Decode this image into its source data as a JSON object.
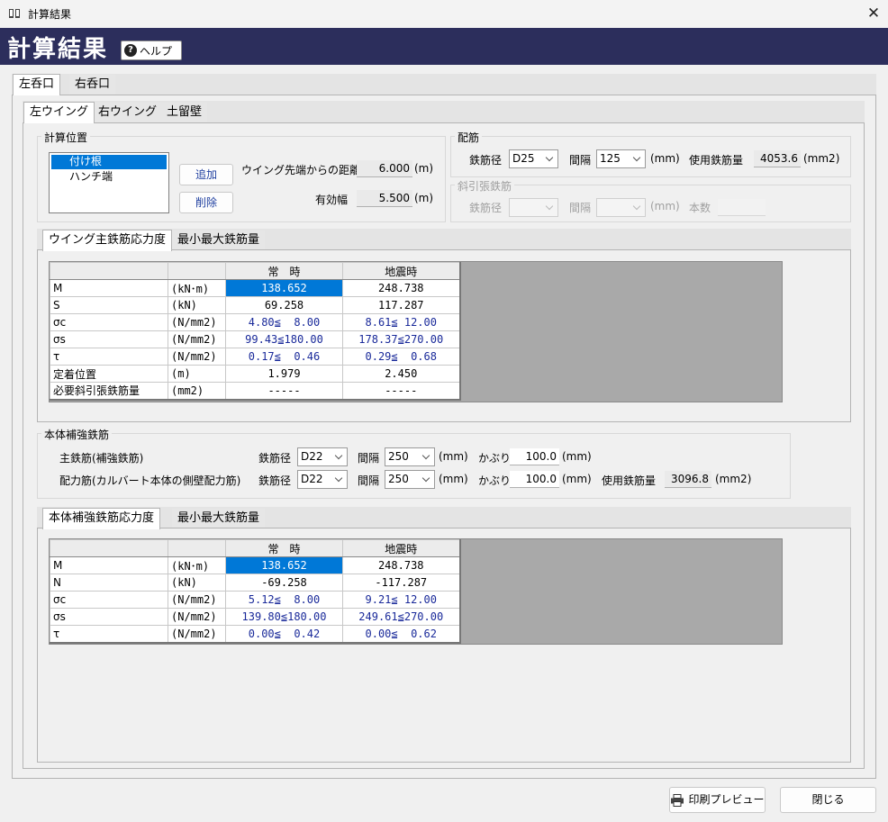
{
  "window": {
    "title": "計算結果",
    "close": "✕"
  },
  "header": {
    "title": "計算結果",
    "help_label": "ヘルプ"
  },
  "outer_tabs": [
    "左呑口",
    "右呑口"
  ],
  "inner_tabs": [
    "左ウイング",
    "右ウイング",
    "土留壁"
  ],
  "calc_position": {
    "label": "計算位置",
    "items": [
      "付け根",
      "ハンチ端"
    ],
    "selected": 0,
    "add_label": "追加",
    "delete_label": "削除",
    "distance_label": "ウイング先端からの距離",
    "distance_value": "6.000",
    "distance_unit": "(m)",
    "width_label": "有効幅",
    "width_value": "5.500",
    "width_unit": "(m)"
  },
  "rebar": {
    "label": "配筋",
    "dia_label": "鉄筋径",
    "dia_value": "D25",
    "spacing_label": "間隔",
    "spacing_value": "125",
    "spacing_unit": "(mm)",
    "used_label": "使用鉄筋量",
    "used_value": "4053.6",
    "used_unit": "(mm2)"
  },
  "diag_rebar": {
    "label": "斜引張鉄筋",
    "dia_label": "鉄筋径",
    "spacing_label": "間隔",
    "spacing_unit": "(mm)",
    "count_label": "本数"
  },
  "wing_tabs": [
    "ウイング主鉄筋応力度",
    "最小最大鉄筋量"
  ],
  "wing_table": {
    "headers": [
      "",
      "",
      "常　時",
      "地震時"
    ],
    "rows": [
      [
        "M",
        "(kN･m)",
        "138.652",
        "248.738"
      ],
      [
        "S",
        "(kN)",
        "69.258",
        "117.287"
      ],
      [
        "σc",
        "(N/mm2)",
        "4.80≦  8.00",
        "8.61≦ 12.00"
      ],
      [
        "σs",
        "(N/mm2)",
        "99.43≦180.00",
        "178.37≦270.00"
      ],
      [
        "τ",
        "(N/mm2)",
        "0.17≦  0.46",
        "0.29≦  0.68"
      ],
      [
        "定着位置",
        "(m)",
        "1.979",
        "2.450"
      ],
      [
        "必要斜引張鉄筋量",
        "(mm2)",
        "-----",
        "-----"
      ]
    ]
  },
  "body_reinf": {
    "label": "本体補強鉄筋",
    "row1_label": "主鉄筋(補強鉄筋)",
    "row2_label": "配力筋(カルバート本体の側壁配力筋)",
    "dia_label": "鉄筋径",
    "spacing_label": "間隔",
    "cover_label": "かぶり",
    "row1": {
      "dia": "D22",
      "spacing": "250",
      "cover": "100.0"
    },
    "row2": {
      "dia": "D22",
      "spacing": "250",
      "cover": "100.0"
    },
    "mm_unit": "(mm)",
    "used_label": "使用鉄筋量",
    "used_value": "3096.8",
    "used_unit": "(mm2)"
  },
  "body_tabs": [
    "本体補強鉄筋応力度",
    "最小最大鉄筋量"
  ],
  "body_table": {
    "headers": [
      "",
      "",
      "常　時",
      "地震時"
    ],
    "rows": [
      [
        "M",
        "(kN･m)",
        "138.652",
        "248.738"
      ],
      [
        "N",
        "(kN)",
        "-69.258",
        "-117.287"
      ],
      [
        "σc",
        "(N/mm2)",
        "5.12≦  8.00",
        "9.21≦ 12.00"
      ],
      [
        "σs",
        "(N/mm2)",
        "139.80≦180.00",
        "249.61≦270.00"
      ],
      [
        "τ",
        "(N/mm2)",
        "0.00≦  0.42",
        "0.00≦  0.62"
      ]
    ]
  },
  "footer": {
    "preview_label": "印刷プレビュー",
    "close_label": "閉じる"
  }
}
